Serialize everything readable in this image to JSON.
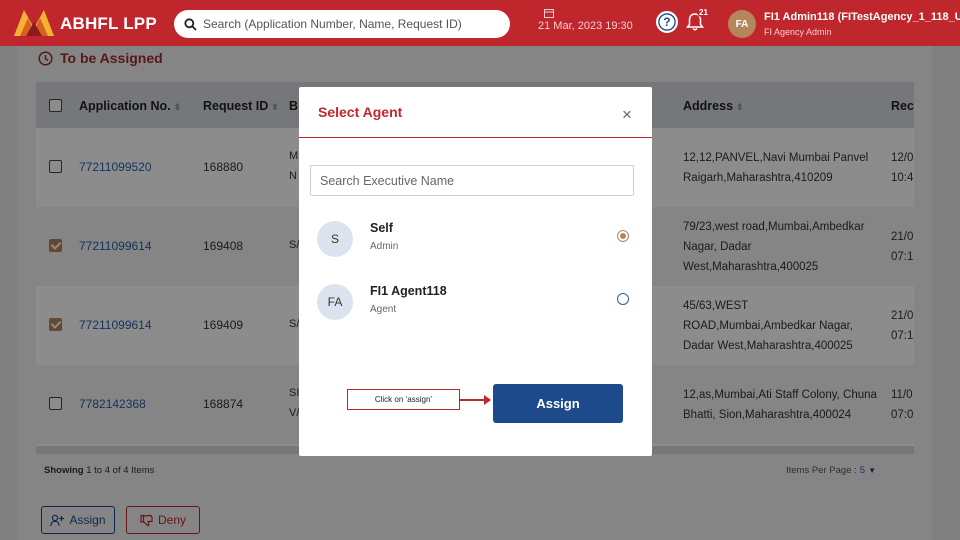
{
  "header": {
    "brand": "ABHFL LPP",
    "search_placeholder": "Search (Application Number, Name, Request ID)",
    "datetime": "21 Mar, 2023 19:30",
    "notification_count": "21",
    "user_initials": "FA",
    "user_name": "FI1 Admin118 (FITestAgency_1_118_Us",
    "user_role": "FI Agency Admin"
  },
  "page": {
    "section_title": "To be Assigned",
    "columns": [
      "Application No.",
      "Request ID",
      "B",
      "Address",
      "Rec"
    ],
    "rows": [
      {
        "checked": false,
        "app_no": "77211099520",
        "request_id": "168880",
        "b_line1": "M",
        "b_line2": "N",
        "address": "12,12,PANVEL,Navi Mumbai Panvel Raigarh,Maharashtra,410209",
        "rec_line1": "12/0",
        "rec_line2": "10:4"
      },
      {
        "checked": true,
        "app_no": "77211099614",
        "request_id": "169408",
        "b_line1": "S/",
        "b_line2": "",
        "address": "79/23,west road,Mumbai,Ambedkar Nagar, Dadar West,Maharashtra,400025",
        "rec_line1": "21/0",
        "rec_line2": "07:1"
      },
      {
        "checked": true,
        "app_no": "77211099614",
        "request_id": "169409",
        "b_line1": "S/",
        "b_line2": "",
        "address": "45/63,WEST ROAD,Mumbai,Ambedkar Nagar, Dadar West,Maharashtra,400025",
        "rec_line1": "21/0",
        "rec_line2": "07:1"
      },
      {
        "checked": false,
        "app_no": "7782142368",
        "request_id": "168874",
        "b_line1": "SI",
        "b_line2": "V/",
        "address": "12,as,Mumbai,Ati Staff Colony, Chuna Bhatti, Sion,Maharashtra,400024",
        "rec_line1": "11/0",
        "rec_line2": "07:0"
      }
    ],
    "showing": {
      "prefix": "Showing ",
      "from": "1",
      "to_word": " to ",
      "to": "4",
      "of_word": " of ",
      "total": "4",
      "suffix": " Items"
    },
    "items_per_page_label": "Items Per Page :",
    "items_per_page_value": "5",
    "assign_label": "Assign",
    "deny_label": "Deny"
  },
  "modal": {
    "title": "Select Agent",
    "search_placeholder": "Search Executive Name",
    "agents": [
      {
        "initials": "S",
        "name": "Self",
        "role": "Admin",
        "selected": true
      },
      {
        "initials": "FA",
        "name": "FI1 Agent118",
        "role": "Agent",
        "selected": false
      }
    ],
    "assign_button": "Assign",
    "callout": "Click on ‘assign’"
  },
  "colors": {
    "brand_red": "#c0272d",
    "primary_blue": "#1c4a8b",
    "accent_gold": "#b5855b"
  }
}
